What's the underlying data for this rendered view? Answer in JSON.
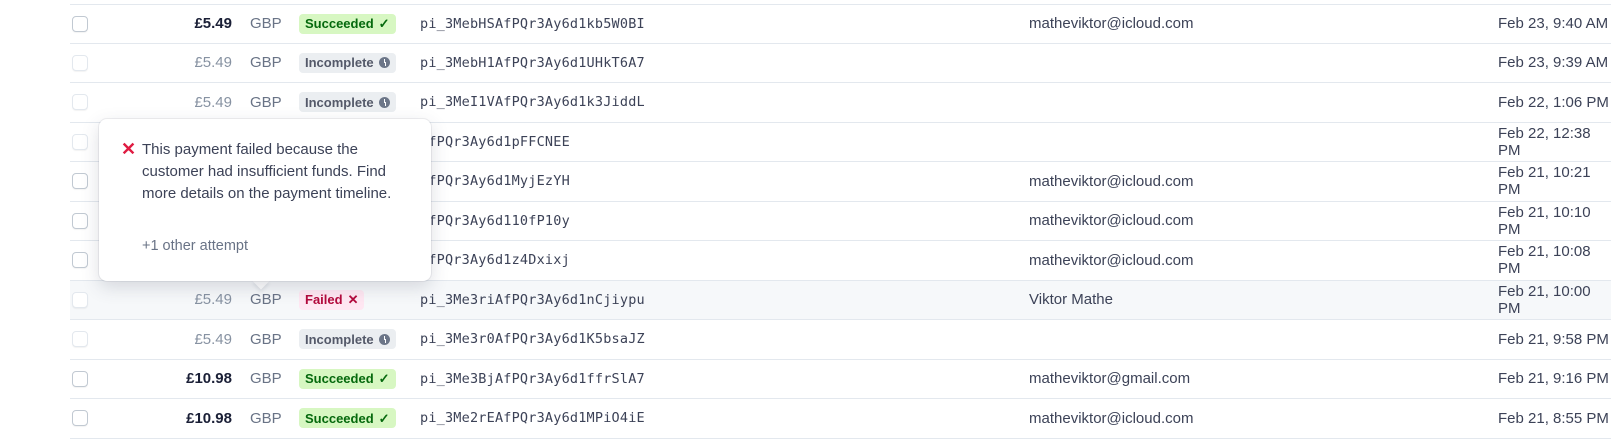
{
  "rows": [
    {
      "amount": "£5.49",
      "currency": "GBP",
      "status": "Succeeded",
      "status_type": "succeeded",
      "id": "pi_3MebHSAfPQr3Ay6d1kb5W0BI",
      "customer": "matheviktor@icloud.com",
      "date": "Feb 23, 9:40 AM",
      "faded": false
    },
    {
      "amount": "£5.49",
      "currency": "GBP",
      "status": "Incomplete",
      "status_type": "incomplete",
      "id": "pi_3MebH1AfPQr3Ay6d1UHkT6A7",
      "customer": "",
      "date": "Feb 23, 9:39 AM",
      "faded": true
    },
    {
      "amount": "£5.49",
      "currency": "GBP",
      "status": "Incomplete",
      "status_type": "incomplete",
      "id": "pi_3MeI1VAfPQr3Ay6d1k3JiddL",
      "customer": "",
      "date": "Feb 22, 1:06 PM",
      "faded": true
    },
    {
      "amount": "",
      "currency": "",
      "status": "",
      "status_type": "",
      "id": "AfPQr3Ay6d1pFFCNEE",
      "customer": "",
      "date": "Feb 22, 12:38 PM",
      "faded": true
    },
    {
      "amount": "",
      "currency": "",
      "status": "",
      "status_type": "",
      "id": "AfPQr3Ay6d1MyjEzYH",
      "customer": "matheviktor@icloud.com",
      "date": "Feb 21, 10:21 PM",
      "faded": false
    },
    {
      "amount": "",
      "currency": "",
      "status": "",
      "status_type": "",
      "id": "AfPQr3Ay6d110fP10y",
      "customer": "matheviktor@icloud.com",
      "date": "Feb 21, 10:10 PM",
      "faded": false
    },
    {
      "amount": "",
      "currency": "",
      "status": "",
      "status_type": "",
      "id": "AfPQr3Ay6d1z4Dxixj",
      "customer": "matheviktor@icloud.com",
      "date": "Feb 21, 10:08 PM",
      "faded": false
    },
    {
      "amount": "£5.49",
      "currency": "GBP",
      "status": "Failed",
      "status_type": "failed",
      "id": "pi_3Me3riAfPQr3Ay6d1nCjiypu",
      "customer": "Viktor Mathe",
      "date": "Feb 21, 10:00 PM",
      "faded": true,
      "highlight": true
    },
    {
      "amount": "£5.49",
      "currency": "GBP",
      "status": "Incomplete",
      "status_type": "incomplete",
      "id": "pi_3Me3r0AfPQr3Ay6d1K5bsaJZ",
      "customer": "",
      "date": "Feb 21, 9:58 PM",
      "faded": true
    },
    {
      "amount": "£10.98",
      "currency": "GBP",
      "status": "Succeeded",
      "status_type": "succeeded",
      "id": "pi_3Me3BjAfPQr3Ay6d1ffrSlA7",
      "customer": "matheviktor@gmail.com",
      "date": "Feb 21, 9:16 PM",
      "faded": false
    },
    {
      "amount": "£10.98",
      "currency": "GBP",
      "status": "Succeeded",
      "status_type": "succeeded",
      "id": "pi_3Me2rEAfPQr3Ay6d1MPiO4iE",
      "customer": "matheviktor@icloud.com",
      "date": "Feb 21, 8:55 PM",
      "faded": false
    }
  ],
  "more_label": "•••",
  "popover": {
    "message": "This payment failed because the customer had insufficient funds. Find more details on the payment timeline.",
    "other_attempts": "+1 other attempt",
    "icon": "close-icon"
  },
  "colors": {
    "succeeded": "#d7f7c2",
    "incomplete": "#ebeef1",
    "failed": "#ffe7f2",
    "error": "#df1b41"
  }
}
